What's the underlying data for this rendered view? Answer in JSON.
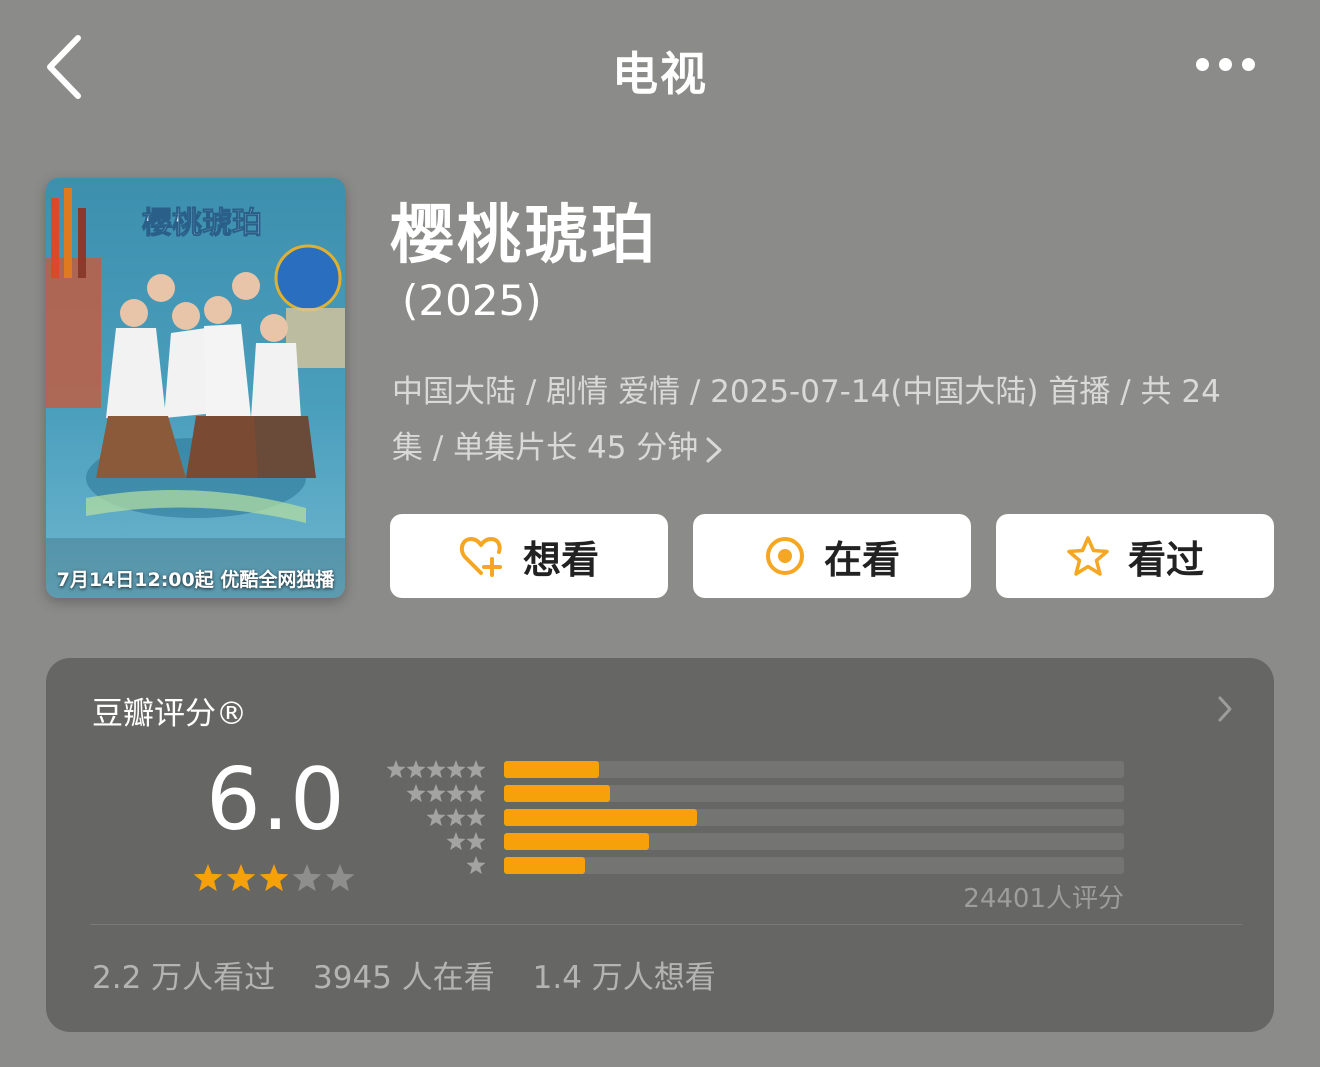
{
  "header": {
    "title": "电视",
    "back_icon": "chevron-left-icon",
    "more_icon": "more-dots-icon"
  },
  "poster": {
    "caption": "7月14日12:00起 优酷全网独播",
    "logo_text": "樱桃琥珀"
  },
  "show": {
    "title": "樱桃琥珀",
    "year": "(2025)",
    "meta_line1": "中国大陆 / 剧情 爱情 / 2025-07-14(中国大陆) 首播 / 共 24",
    "meta_line2": "集 / 单集片长 45 分钟"
  },
  "actions": {
    "want_label": "想看",
    "watching_label": "在看",
    "watched_label": "看过",
    "accent_color": "#f5a623"
  },
  "rating": {
    "title": "豆瓣评分®",
    "score": "6.0",
    "stars": 3,
    "max_stars": 5,
    "count_label": "24401人评分",
    "distribution": [
      {
        "stars": 5,
        "fraction": 0.153
      },
      {
        "stars": 4,
        "fraction": 0.171
      },
      {
        "stars": 3,
        "fraction": 0.311
      },
      {
        "stars": 2,
        "fraction": 0.234
      },
      {
        "stars": 1,
        "fraction": 0.131
      }
    ],
    "bar_color": "#f7a10a"
  },
  "stats": {
    "watched": "2.2 万人看过",
    "watching": "3945 人在看",
    "want": "1.4 万人想看"
  }
}
